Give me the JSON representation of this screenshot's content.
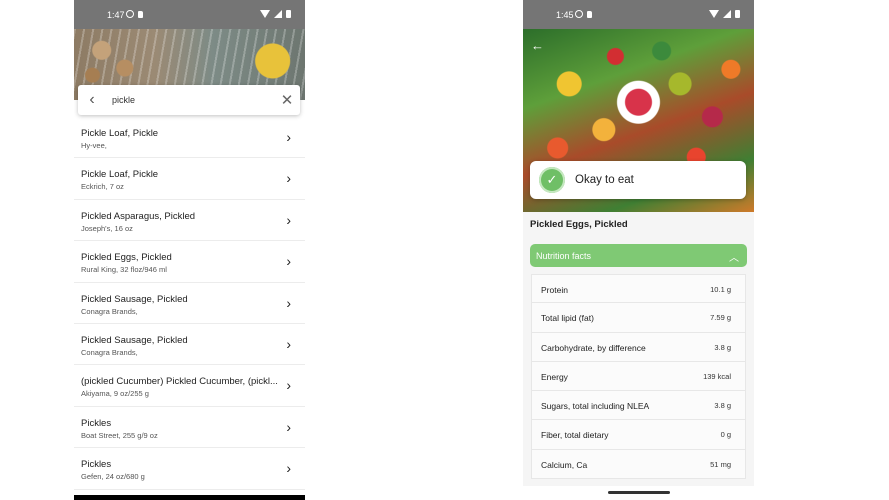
{
  "left_screen": {
    "status_time": "1:47",
    "search": {
      "query": "pickle"
    },
    "results": [
      {
        "name": "Pickle Loaf, Pickle",
        "detail": "Hy-vee,"
      },
      {
        "name": "Pickle Loaf, Pickle",
        "detail": "Eckrich, 7 oz"
      },
      {
        "name": "Pickled Asparagus, Pickled",
        "detail": "Joseph's, 16 oz"
      },
      {
        "name": "Pickled Eggs, Pickled",
        "detail": "Rural King, 32 floz/946 ml"
      },
      {
        "name": "Pickled Sausage, Pickled",
        "detail": "Conagra Brands,"
      },
      {
        "name": "Pickled Sausage, Pickled",
        "detail": "Conagra Brands,"
      },
      {
        "name": "(pickled Cucumber) Pickled Cucumber, (pickl...",
        "detail": "Akiyama, 9 oz/255 g"
      },
      {
        "name": "Pickles",
        "detail": "Boat Street, 255 g/9 oz"
      },
      {
        "name": "Pickles",
        "detail": "Gefen, 24 oz/680 g"
      }
    ]
  },
  "right_screen": {
    "status_time": "1:45",
    "verdict": "Okay to eat",
    "food_title": "Pickled Eggs, Pickled",
    "nutrition_header": "Nutrition facts",
    "nutrients": [
      {
        "name": "Protein",
        "value": "10.1 g"
      },
      {
        "name": "Total lipid (fat)",
        "value": "7.59 g"
      },
      {
        "name": "Carbohydrate, by difference",
        "value": "3.8 g"
      },
      {
        "name": "Energy",
        "value": "139 kcal"
      },
      {
        "name": "Sugars, total including NLEA",
        "value": "3.8 g"
      },
      {
        "name": "Fiber, total dietary",
        "value": "0 g"
      },
      {
        "name": "Calcium, Ca",
        "value": "51 mg"
      }
    ]
  },
  "colors": {
    "accent_green": "#7fc974",
    "status_bar": "#757575"
  }
}
